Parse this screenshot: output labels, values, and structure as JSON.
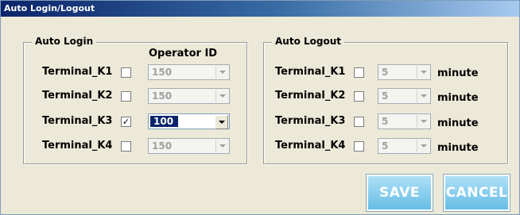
{
  "window": {
    "title": "Auto Login/Logout"
  },
  "auto_login": {
    "legend": "Auto Login",
    "operator_id_header": "Operator ID",
    "rows": [
      {
        "label": "Terminal_K1",
        "checked": false,
        "check_mark": "",
        "operator_id": "150"
      },
      {
        "label": "Terminal_K2",
        "checked": false,
        "check_mark": "",
        "operator_id": "150"
      },
      {
        "label": "Terminal_K3",
        "checked": true,
        "check_mark": "✓",
        "operator_id": "100"
      },
      {
        "label": "Terminal_K4",
        "checked": false,
        "check_mark": "",
        "operator_id": "150"
      }
    ]
  },
  "auto_logout": {
    "legend": "Auto Logout",
    "unit": "minute",
    "rows": [
      {
        "label": "Terminal_K1",
        "checked": false,
        "check_mark": "",
        "minutes": "5"
      },
      {
        "label": "Terminal_K2",
        "checked": false,
        "check_mark": "",
        "minutes": "5"
      },
      {
        "label": "Terminal_K3",
        "checked": false,
        "check_mark": "",
        "minutes": "5"
      },
      {
        "label": "Terminal_K4",
        "checked": false,
        "check_mark": "",
        "minutes": "5"
      }
    ]
  },
  "buttons": {
    "save": "SAVE",
    "cancel": "CANCEL"
  },
  "colors": {
    "button_top": "#aee0f7",
    "button_bottom": "#66bde6",
    "selection": "#0a246a",
    "window_bg": "#ece9d8"
  }
}
